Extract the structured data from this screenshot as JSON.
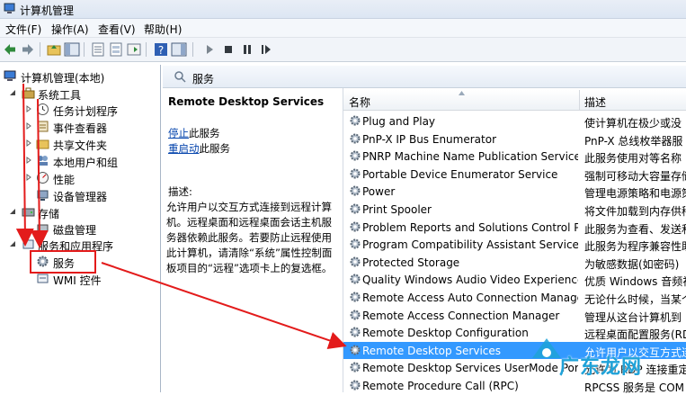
{
  "window": {
    "title": "计算机管理"
  },
  "menu": [
    "文件(F)",
    "操作(A)",
    "查看(V)",
    "帮助(H)"
  ],
  "toolbar_icons": [
    "back-icon",
    "forward-icon",
    "up-folder-icon",
    "show-hide-tree-icon",
    "export-list-icon",
    "properties-icon",
    "refresh-icon",
    "help-icon",
    "show-action-pane-icon",
    "play-icon",
    "stop-icon",
    "pause-icon",
    "restart-icon"
  ],
  "tree": {
    "root": "计算机管理(本地)",
    "system_tools": "系统工具",
    "task_scheduler": "任务计划程序",
    "event_viewer": "事件查看器",
    "shared_folders": "共享文件夹",
    "local_users": "本地用户和组",
    "performance": "性能",
    "device_manager": "设备管理器",
    "storage": "存储",
    "disk_management": "磁盘管理",
    "services_apps": "服务和应用程序",
    "services": "服务",
    "wmi": "WMI 控件"
  },
  "panel_header": "服务",
  "detail": {
    "service_name": "Remote Desktop Services",
    "stop_link": "停止",
    "stop_suffix": "此服务",
    "restart_link": "重启动",
    "restart_suffix": "此服务",
    "desc_label": "描述:",
    "desc_text": "允许用户以交互方式连接到远程计算机。远程桌面和远程桌面会话主机服务器依赖此服务。若要防止远程使用此计算机，请清除“系统”属性控制面板项目的“远程”选项卡上的复选框。"
  },
  "columns": {
    "name": "名称",
    "description": "描述"
  },
  "services": [
    {
      "name": "Plug and Play",
      "desc": "使计算机在极少或没"
    },
    {
      "name": "PnP-X IP Bus Enumerator",
      "desc": "PnP-X 总线枚举器服"
    },
    {
      "name": "PNRP Machine Name Publication Service",
      "desc": "此服务使用对等名称"
    },
    {
      "name": "Portable Device Enumerator Service",
      "desc": "强制可移动大容量存储"
    },
    {
      "name": "Power",
      "desc": "管理电源策略和电源策"
    },
    {
      "name": "Print Spooler",
      "desc": "将文件加载到内存供稍"
    },
    {
      "name": "Problem Reports and Solutions Control Pa...",
      "desc": "此服务为查看、发送和"
    },
    {
      "name": "Program Compatibility Assistant Service",
      "desc": "此服务为程序兼容性助"
    },
    {
      "name": "Protected Storage",
      "desc": "为敏感数据(如密码)"
    },
    {
      "name": "Quality Windows Audio Video Experience",
      "desc": "优质 Windows 音频视"
    },
    {
      "name": "Remote Access Auto Connection Manager",
      "desc": "无论什么时候，当某个"
    },
    {
      "name": "Remote Access Connection Manager",
      "desc": "管理从这台计算机到 In"
    },
    {
      "name": "Remote Desktop Configuration",
      "desc": "远程桌面配置服务(RDC"
    },
    {
      "name": "Remote Desktop Services",
      "desc": "允许用户以交互方式连"
    },
    {
      "name": "Remote Desktop Services UserMode Port ...",
      "desc": "允许为 RDP 连接重定向"
    },
    {
      "name": "Remote Procedure Call (RPC)",
      "desc": "RPCSS 服务是 COM 和"
    }
  ],
  "selected_service": "Remote Desktop Services",
  "watermark": "广东龙网",
  "colors": {
    "selection": "#3399ff",
    "annotation_red": "#e31b1b",
    "link": "#0645ad"
  }
}
